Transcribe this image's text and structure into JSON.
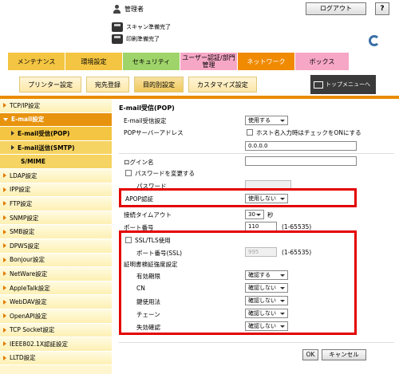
{
  "header": {
    "user": "管理者",
    "logout": "ログアウト",
    "help": "?",
    "scan_status": "スキャン準備完了",
    "print_status": "印刷準備完了"
  },
  "tabs": [
    {
      "label": "メンテナンス",
      "color": "#f4c542"
    },
    {
      "label": "環境設定",
      "color": "#f4c542"
    },
    {
      "label": "セキュリティ",
      "color": "#9fd46a"
    },
    {
      "label": "ユーザー認証/部門管理",
      "color": "#f7a7c6"
    },
    {
      "label": "ネットワーク",
      "color": "#f08a00"
    },
    {
      "label": "ボックス",
      "color": "#f7a7c6"
    }
  ],
  "subtabs": [
    {
      "label": "プリンター設定"
    },
    {
      "label": "宛先登録"
    },
    {
      "label": "目的別設定"
    },
    {
      "label": "カスタマイズ設定"
    }
  ],
  "top_menu": "トップメニューへ",
  "sidebar": {
    "items": [
      {
        "label": "TCP/IP設定"
      },
      {
        "label": "E-mail設定"
      },
      {
        "label": "E-mail受信(POP)"
      },
      {
        "label": "E-mail送信(SMTP)"
      },
      {
        "label": "S/MIME"
      },
      {
        "label": "LDAP設定"
      },
      {
        "label": "IPP設定"
      },
      {
        "label": "FTP設定"
      },
      {
        "label": "SNMP設定"
      },
      {
        "label": "SMB設定"
      },
      {
        "label": "DPWS設定"
      },
      {
        "label": "Bonjour設定"
      },
      {
        "label": "NetWare設定"
      },
      {
        "label": "AppleTalk設定"
      },
      {
        "label": "WebDAV設定"
      },
      {
        "label": "OpenAPI設定"
      },
      {
        "label": "TCP Socket設定"
      },
      {
        "label": "IEEE802.1X認証設定"
      },
      {
        "label": "LLTD設定"
      }
    ]
  },
  "form": {
    "title": "E-mail受信(POP)",
    "pop_setting": {
      "label": "E-mail受信設定",
      "value": "使用する"
    },
    "pop_server": {
      "label": "POPサーバーアドレス",
      "hint": "ホスト名入力時はチェックをONにする",
      "value": "0.0.0.0"
    },
    "login": {
      "label": "ログイン名",
      "value": ""
    },
    "change_password": {
      "label": "パスワードを変更する"
    },
    "password": {
      "label": "パスワード",
      "value": ""
    },
    "apop": {
      "label": "APOP認証",
      "value": "使用しない"
    },
    "timeout": {
      "label": "接続タイムアウト",
      "value": "30",
      "unit": "秒"
    },
    "port": {
      "label": "ポート番号",
      "value": "110",
      "range": "(1-65535)"
    },
    "ssl": {
      "label": "SSL/TLS使用"
    },
    "ssl_port": {
      "label": "ポート番号(SSL)",
      "value": "995",
      "range": "(1-65535)"
    },
    "cert_strength": {
      "label": "証明書検証強度設定"
    },
    "cert_rows": [
      {
        "label": "有効期限",
        "value": "確認する"
      },
      {
        "label": "CN",
        "value": "確認しない"
      },
      {
        "label": "鍵使用法",
        "value": "確認しない"
      },
      {
        "label": "チェーン",
        "value": "確認しない"
      },
      {
        "label": "失効確認",
        "value": "確認しない"
      }
    ],
    "ok": "OK",
    "cancel": "キャンセル"
  }
}
